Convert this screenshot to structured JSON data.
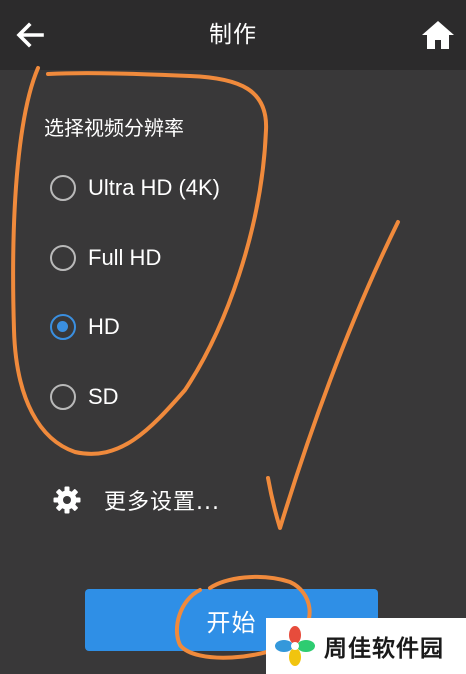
{
  "header": {
    "title": "制作",
    "back_icon": "back-arrow-icon",
    "home_icon": "home-icon"
  },
  "resolution": {
    "section_title": "选择视频分辨率",
    "options": [
      {
        "label": "Ultra HD (4K)",
        "selected": false
      },
      {
        "label": "Full HD",
        "selected": false
      },
      {
        "label": "HD",
        "selected": true
      },
      {
        "label": "SD",
        "selected": false
      }
    ]
  },
  "more_settings": {
    "label": "更多设置...",
    "icon": "gear-icon"
  },
  "start_button": {
    "label": "开始"
  },
  "watermark": {
    "text": "周佳软件园",
    "icon": "flower-logo-icon"
  },
  "colors": {
    "background": "#393839",
    "header": "#2c2b2c",
    "accent": "#2f8fe6",
    "annotation": "#f08a3c"
  }
}
